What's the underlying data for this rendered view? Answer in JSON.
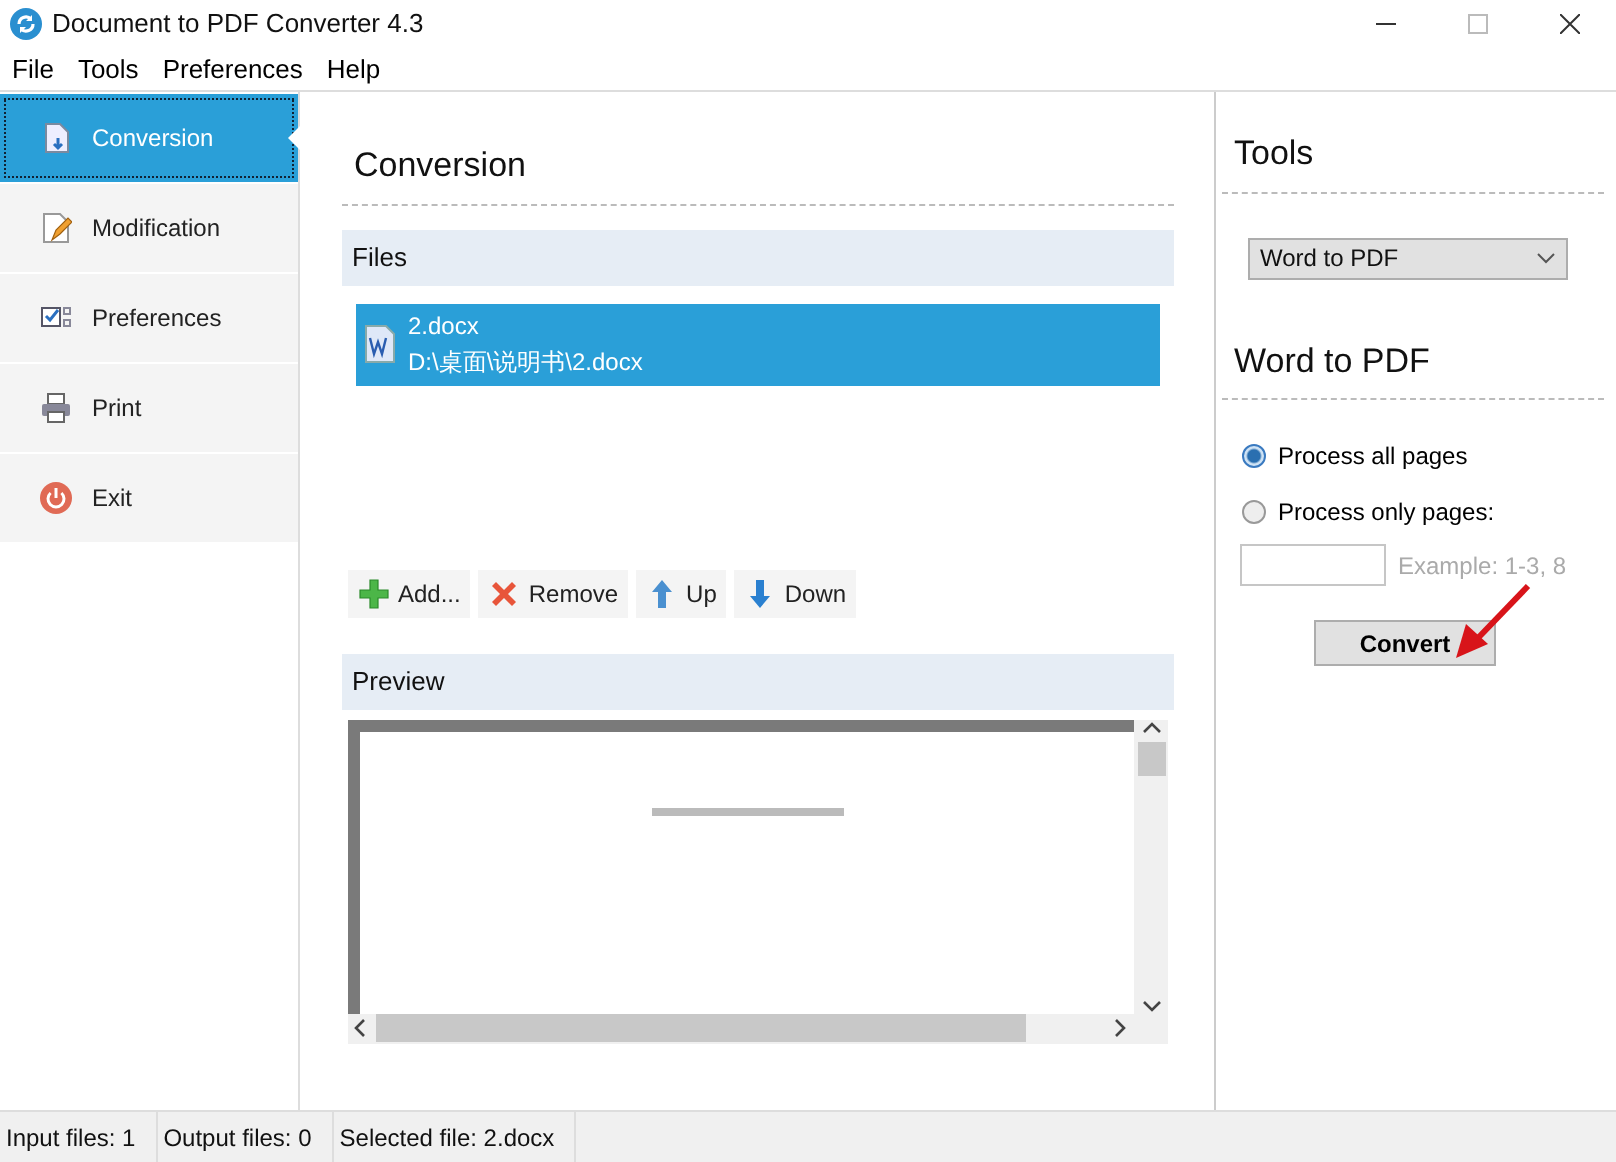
{
  "window": {
    "title": "Document to PDF Converter 4.3"
  },
  "menu": [
    "File",
    "Tools",
    "Preferences",
    "Help"
  ],
  "sidebar": {
    "items": [
      {
        "label": "Conversion",
        "kind": "convert",
        "selected": true
      },
      {
        "label": "Modification",
        "kind": "edit",
        "selected": false
      },
      {
        "label": "Preferences",
        "kind": "options",
        "selected": false
      },
      {
        "label": "Print",
        "kind": "print",
        "selected": false
      },
      {
        "label": "Exit",
        "kind": "exit",
        "selected": false
      }
    ]
  },
  "conversion": {
    "title": "Conversion",
    "files_header": "Files",
    "files": [
      {
        "name": "2.docx",
        "path": "D:\\桌面\\说明书\\2.docx",
        "selected": true
      }
    ],
    "buttons": [
      {
        "label": "Add...",
        "kind": "add"
      },
      {
        "label": "Remove",
        "kind": "remove"
      },
      {
        "label": "Up",
        "kind": "up"
      },
      {
        "label": "Down",
        "kind": "down"
      }
    ],
    "preview_header": "Preview"
  },
  "tools": {
    "title": "Tools",
    "converter": "Word to PDF",
    "section_title": "Word to PDF",
    "options": [
      {
        "label": "Process all pages",
        "selected": true
      },
      {
        "label": "Process only pages:",
        "selected": false
      }
    ],
    "pages_hint": "Example: 1-3, 8",
    "convert_button": "Convert"
  },
  "status_bar": [
    "Input files: 1",
    "Output files: 0",
    "Selected file: 2.docx"
  ]
}
